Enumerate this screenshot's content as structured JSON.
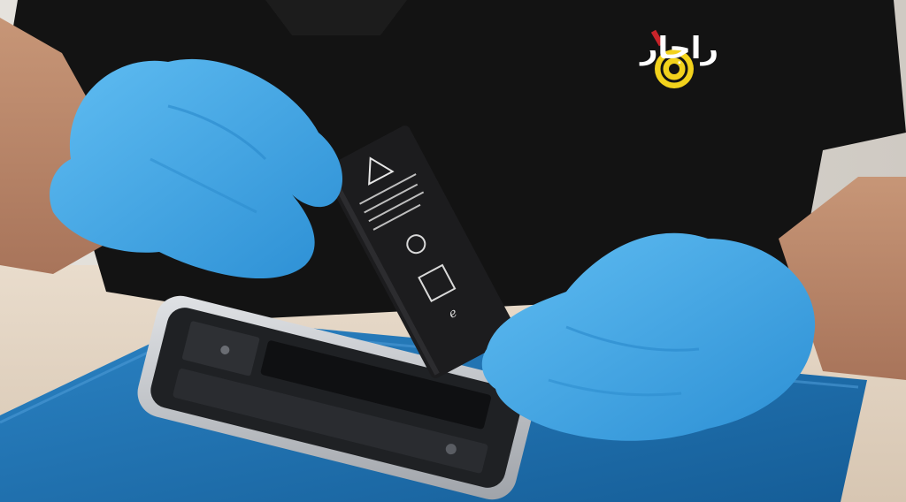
{
  "photo": {
    "subject": "",
    "logo_text": "راجار",
    "battery_text": "ℯ"
  },
  "colors": {
    "background": "#d9d6d1",
    "shirt": "#121212",
    "skin": "#b98466",
    "glove": "#3aa3e6",
    "glove_shadow": "#1f7fc0",
    "mat": "#1d6fae",
    "table": "#e3d4c3",
    "phone_frame": "#b9bcc2",
    "phone_inner": "#1f2124",
    "battery": "#1c1c1e",
    "logo_yellow": "#f2d21c",
    "logo_red": "#c9242a"
  }
}
